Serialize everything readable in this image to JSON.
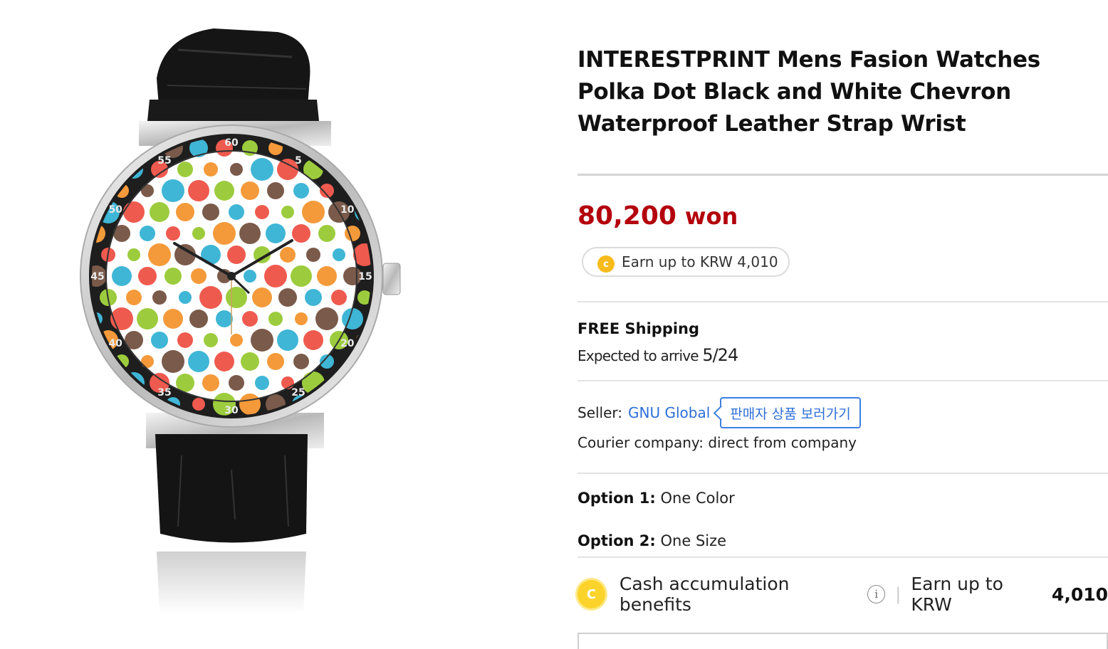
{
  "product": {
    "title": "INTERESTPRINT Mens Fasion Watches Polka Dot Black and White Chevron Waterproof Leather Strap Wrist",
    "image_alt": "watch-product-image",
    "bezel_numbers": [
      "5",
      "10",
      "15",
      "20",
      "25",
      "30",
      "35",
      "40",
      "45",
      "50",
      "55",
      "60"
    ]
  },
  "price": {
    "amount": "80,200",
    "unit": "won"
  },
  "reward": {
    "coin_letter": "c",
    "text": "Earn up to KRW 4,010"
  },
  "shipping": {
    "title": "FREE Shipping",
    "expected_label": "Expected to arrive",
    "date": "5/24"
  },
  "seller": {
    "label": "Seller:",
    "name": "GNU Global",
    "button": "판매자 상품 보러가기"
  },
  "courier": {
    "text": "Courier company: direct from company"
  },
  "options": [
    {
      "label": "Option 1:",
      "value": "One Color"
    },
    {
      "label": "Option 2:",
      "value": "One Size"
    }
  ],
  "benefits": {
    "coin_letter": "C",
    "label": "Cash accumulation benefits",
    "info_icon": "i",
    "separator": "|",
    "earn_prefix": "Earn up to KRW",
    "earn_amount": "4,010"
  },
  "colors": {
    "price_red": "#b3000c",
    "link_blue": "#2d6fd8",
    "coin_yellow": "#f8bb1c"
  }
}
